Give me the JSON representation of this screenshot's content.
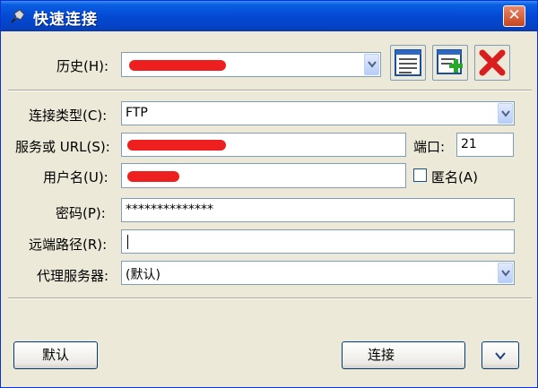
{
  "window": {
    "title": "快速连接",
    "icon": "pin-icon",
    "close_label": "✕"
  },
  "history": {
    "label": "历史(H):",
    "value_redacted": true
  },
  "toolbar_buttons": [
    {
      "name": "manage-list-button",
      "icon": "list-icon"
    },
    {
      "name": "add-button",
      "icon": "add-icon"
    },
    {
      "name": "delete-button",
      "icon": "delete-icon"
    }
  ],
  "connection_type": {
    "label": "连接类型(C):",
    "value": "FTP"
  },
  "server": {
    "label": "服务或 URL(S):",
    "value_redacted": true,
    "port_label": "端口:",
    "port_value": "21"
  },
  "username": {
    "label": "用户名(U):",
    "value_redacted": true,
    "anonymous_label": "匿名(A)",
    "anonymous_checked": false
  },
  "password": {
    "label": "密码(P):",
    "value": "**************"
  },
  "remote_path": {
    "label": "远端路径(R):",
    "value": ""
  },
  "proxy": {
    "label": "代理服务器:",
    "value": "(默认)"
  },
  "buttons": {
    "default_label": "默认",
    "connect_label": "连接"
  },
  "colors": {
    "titlebar": "#0449d4",
    "dialog_bg": "#ece9d8",
    "field_border": "#7f9db9",
    "redaction": "#ee1f1f"
  }
}
